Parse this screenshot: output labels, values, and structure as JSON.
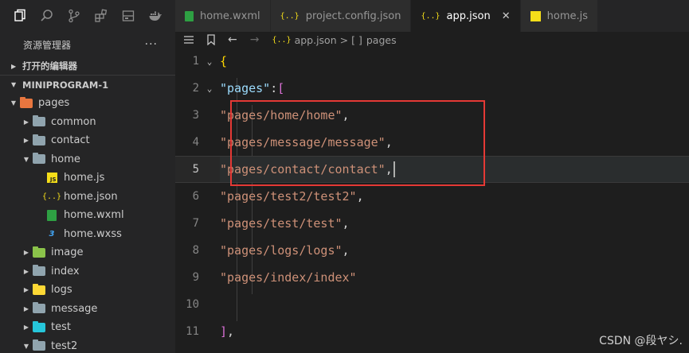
{
  "activity_bar": {
    "icons": [
      "explorer-icon",
      "search-icon",
      "source-control-icon",
      "extensions-icon",
      "storage-icon",
      "docker-icon"
    ]
  },
  "sidebar": {
    "title": "资源管理器",
    "more": "···",
    "open_editors": "打开的编辑器",
    "project": "MINIPROGRAM-1",
    "tree": [
      {
        "label": "pages",
        "depth": 1,
        "kind": "folder-open",
        "color": "#e8763f"
      },
      {
        "label": "common",
        "depth": 2,
        "kind": "folder",
        "color": "#90a4ae"
      },
      {
        "label": "contact",
        "depth": 2,
        "kind": "folder",
        "color": "#90a4ae"
      },
      {
        "label": "home",
        "depth": 2,
        "kind": "folder-open",
        "color": "#90a4ae"
      },
      {
        "label": "home.js",
        "depth": 3,
        "kind": "js"
      },
      {
        "label": "home.json",
        "depth": 3,
        "kind": "json"
      },
      {
        "label": "home.wxml",
        "depth": 3,
        "kind": "wxml"
      },
      {
        "label": "home.wxss",
        "depth": 3,
        "kind": "css"
      },
      {
        "label": "image",
        "depth": 2,
        "kind": "folder",
        "color": "#8bc34a"
      },
      {
        "label": "index",
        "depth": 2,
        "kind": "folder",
        "color": "#90a4ae"
      },
      {
        "label": "logs",
        "depth": 2,
        "kind": "folder",
        "color": "#fdd835"
      },
      {
        "label": "message",
        "depth": 2,
        "kind": "folder",
        "color": "#90a4ae"
      },
      {
        "label": "test",
        "depth": 2,
        "kind": "folder",
        "color": "#26c6da"
      },
      {
        "label": "test2",
        "depth": 2,
        "kind": "folder-open",
        "color": "#90a4ae"
      }
    ]
  },
  "tabs": [
    {
      "label": "home.wxml",
      "icon": "wxml",
      "active": false
    },
    {
      "label": "project.config.json",
      "icon": "json",
      "active": false
    },
    {
      "label": "app.json",
      "icon": "json",
      "active": true,
      "close": "✕"
    },
    {
      "label": "home.js",
      "icon": "js",
      "active": false
    }
  ],
  "breadcrumb": {
    "file": "app.json",
    "sep": ">",
    "node_icon": "[ ]",
    "node": "pages"
  },
  "editor": {
    "lines": [
      {
        "n": "1",
        "text": "{"
      },
      {
        "n": "2",
        "text": "  \"pages\": ["
      },
      {
        "n": "3",
        "text": "    \"pages/home/home\","
      },
      {
        "n": "4",
        "text": "    \"pages/message/message\","
      },
      {
        "n": "5",
        "text": "    \"pages/contact/contact\","
      },
      {
        "n": "6",
        "text": "    \"pages/test2/test2\","
      },
      {
        "n": "7",
        "text": "    \"pages/test/test\","
      },
      {
        "n": "8",
        "text": "    \"pages/logs/logs\","
      },
      {
        "n": "9",
        "text": "    \"pages/index/index\""
      },
      {
        "n": "10",
        "text": ""
      },
      {
        "n": "11",
        "text": "  ],"
      }
    ],
    "current_line": "5"
  },
  "watermark": "CSDN @段ヤシ."
}
